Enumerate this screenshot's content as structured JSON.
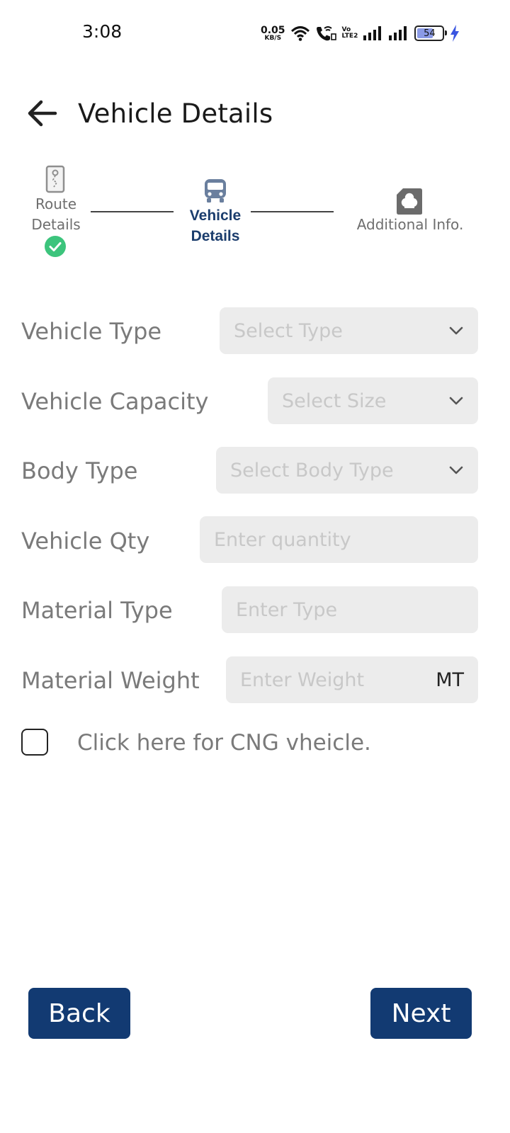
{
  "status_bar": {
    "time": "3:08",
    "net_speed_value": "0.05",
    "net_speed_unit": "KB/S",
    "volte_top": "Vo",
    "volte_bottom": "LTE2",
    "battery_level": "54",
    "icons": [
      "wifi-icon",
      "wifi-calling-icon",
      "signal-icon",
      "signal-icon",
      "battery-icon",
      "charging-icon"
    ]
  },
  "header": {
    "title": "Vehicle Details"
  },
  "stepper": {
    "steps": [
      {
        "label_line1": "Route",
        "label_line2": "Details",
        "state": "completed",
        "icon": "route-map-icon"
      },
      {
        "label_line1": "Vehicle",
        "label_line2": "Details",
        "state": "active",
        "icon": "bus-icon"
      },
      {
        "label_line1": "Additional Info.",
        "state": "pending",
        "icon": "document-icon"
      }
    ],
    "colors": {
      "active": "#1b3d6d",
      "completed": "#3cc47c",
      "inactive": "#6e6e6e"
    }
  },
  "form": {
    "vehicle_type": {
      "label": "Vehicle Type",
      "placeholder": "Select Type"
    },
    "vehicle_capacity": {
      "label": "Vehicle Capacity",
      "placeholder": "Select Size"
    },
    "body_type": {
      "label": "Body Type",
      "placeholder": "Select Body Type"
    },
    "vehicle_qty": {
      "label": "Vehicle Qty",
      "placeholder": "Enter quantity"
    },
    "material_type": {
      "label": "Material Type",
      "placeholder": "Enter Type"
    },
    "material_weight": {
      "label": "Material Weight",
      "placeholder": "Enter Weight",
      "unit": "MT"
    },
    "cng_checkbox": {
      "label": "Click here for CNG vheicle.",
      "checked": false
    }
  },
  "buttons": {
    "back": "Back",
    "next": "Next",
    "color": "#123a72"
  }
}
